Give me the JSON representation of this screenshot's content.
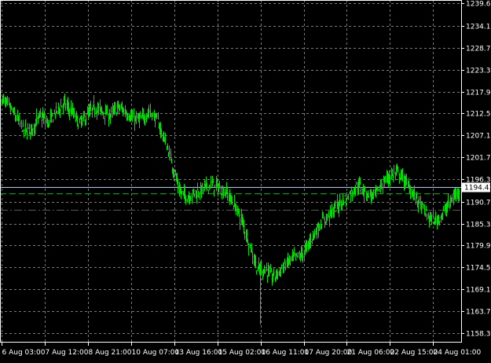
{
  "chart_data": {
    "type": "line",
    "style": "bars",
    "colors": {
      "background": "#000000",
      "grid": "#7a7a7a",
      "axis": "#ffffff",
      "bars": "#00e000",
      "bid_line": "#b4c8dc",
      "ask_line": "#1e8c1e",
      "stop_line": "#e02020",
      "price_label_bg": "#ffffff",
      "price_label_text": "#000000"
    },
    "grid": true,
    "ylim": [
      1156,
      1240.5
    ],
    "y_ticks": [
      "1239.65",
      "1234.10",
      "1228.70",
      "1223.30",
      "1217.90",
      "1212.50",
      "1207.10",
      "1201.70",
      "1196.30",
      "1190.75",
      "1185.35",
      "1179.95",
      "1174.55",
      "1169.15",
      "1163.75",
      "1158.35"
    ],
    "x_ticks": [
      "6 Aug 03:00",
      "7 Aug 12:00",
      "8 Aug 21:00",
      "10 Aug 07:00",
      "13 Aug 16:00",
      "15 Aug 02:00",
      "16 Aug 11:00",
      "17 Aug 20:00",
      "21 Aug 06:00",
      "22 Aug 15:00",
      "24 Aug 01:00"
    ],
    "current_price": "1194.43",
    "levels": {
      "bid": 1194.43,
      "ask": 1192.9,
      "stop": 1188.8
    },
    "series": [
      {
        "values": [
          1216,
          1214,
          1211,
          1208,
          1209,
          1212,
          1210,
          1213,
          1215,
          1213,
          1210,
          1212,
          1214,
          1213,
          1212,
          1214,
          1213,
          1211,
          1211,
          1213,
          1211,
          1206,
          1200,
          1193,
          1192,
          1193,
          1194,
          1195,
          1194,
          1193,
          1190,
          1186,
          1180,
          1174,
          1174,
          1172,
          1174,
          1176,
          1177,
          1178,
          1182,
          1185,
          1187,
          1189,
          1191,
          1193,
          1195,
          1193,
          1192,
          1195,
          1197,
          1198,
          1196,
          1193,
          1190,
          1187,
          1186,
          1188,
          1191,
          1194
        ]
      }
    ]
  }
}
